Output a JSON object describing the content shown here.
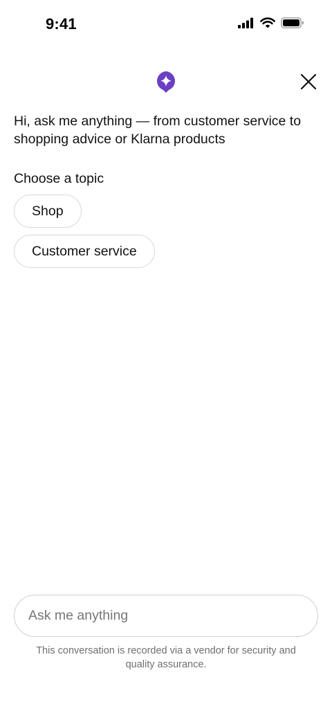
{
  "status_bar": {
    "time": "9:41",
    "icons": [
      "cellular-signal-icon",
      "wifi-icon",
      "battery-icon"
    ]
  },
  "header": {
    "logo_icon": "sparkle-chat-bubble-icon",
    "close_icon": "close-icon"
  },
  "colors": {
    "accent": "#6b3fc2",
    "text": "#111111",
    "muted": "#6f6f6f",
    "border": "#d8d8d8"
  },
  "chat": {
    "greeting": "Hi, ask me anything — from customer service to shopping advice or Klarna products",
    "topic_heading": "Choose a topic",
    "topics": [
      {
        "label": "Shop"
      },
      {
        "label": "Customer service"
      }
    ]
  },
  "composer": {
    "placeholder": "Ask me anything",
    "value": "",
    "disclaimer": "This conversation is recorded via a vendor for security and quality assurance."
  }
}
